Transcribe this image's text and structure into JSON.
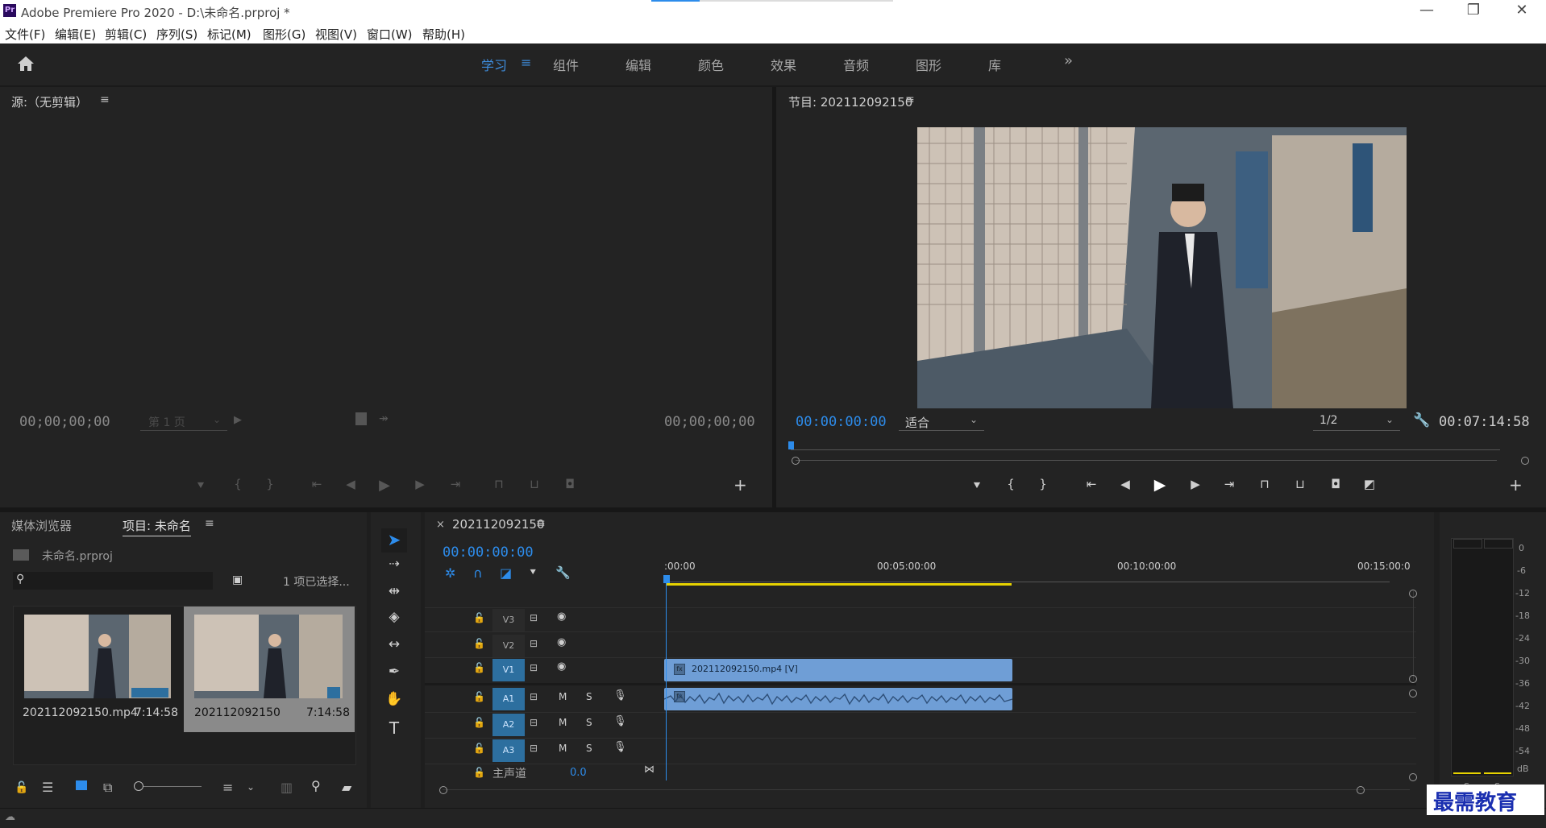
{
  "window": {
    "title": "Adobe Premiere Pro 2020 - D:\\未命名.prproj *",
    "app_badge": "Pr",
    "minimize": "—",
    "restore": "❐",
    "close": "✕"
  },
  "menu": [
    "文件(F)",
    "编辑(E)",
    "剪辑(C)",
    "序列(S)",
    "标记(M)",
    "图形(G)",
    "视图(V)",
    "窗口(W)",
    "帮助(H)"
  ],
  "workspaces": {
    "tabs": [
      "学习",
      "组件",
      "编辑",
      "颜色",
      "效果",
      "音频",
      "图形",
      "库"
    ],
    "active": "学习",
    "more": "»"
  },
  "source": {
    "title": "源:（无剪辑）",
    "timecode_in": "00;00;00;00",
    "timecode_out": "00;00;00;00",
    "page": "第 1 页"
  },
  "program": {
    "title": "节目: 202112092150",
    "timecode": "00:00:00:00",
    "fit": "适合",
    "resolution": "1/2",
    "duration": "00:07:14:58"
  },
  "project": {
    "tabs": [
      "媒体浏览器",
      "项目: 未命名"
    ],
    "project_file": "未命名.prproj",
    "search_placeholder": "",
    "selection": "1 项已选择...",
    "items": [
      {
        "name": "202112092150.mp4",
        "duration": "7:14:58",
        "selected": false
      },
      {
        "name": "202112092150",
        "duration": "7:14:58",
        "selected": true
      }
    ]
  },
  "timeline": {
    "sequence": "202112092150",
    "timecode": "00:00:00:00",
    "ruler": [
      ":00:00",
      "00:05:00:00",
      "00:10:00:00",
      "00:15:00:0"
    ],
    "tracks": {
      "video": [
        "V3",
        "V2",
        "V1"
      ],
      "audio": [
        "A1",
        "A2",
        "A3"
      ],
      "mute": "M",
      "solo": "S"
    },
    "clip_label": "202112092150.mp4 [V]",
    "master_label": "主声道",
    "master_value": "0.0"
  },
  "meter": {
    "scale": [
      "0",
      "-6",
      "-12",
      "-18",
      "-24",
      "-30",
      "-36",
      "-42",
      "-48",
      "-54",
      "dB"
    ],
    "solo": [
      "S",
      "S"
    ]
  },
  "watermark": "最需教育",
  "colors": {
    "accent": "#2d8ceb",
    "clip_blue": "#6f9ed6",
    "work_area": "#e6d200",
    "panel_bg": "#232323"
  }
}
